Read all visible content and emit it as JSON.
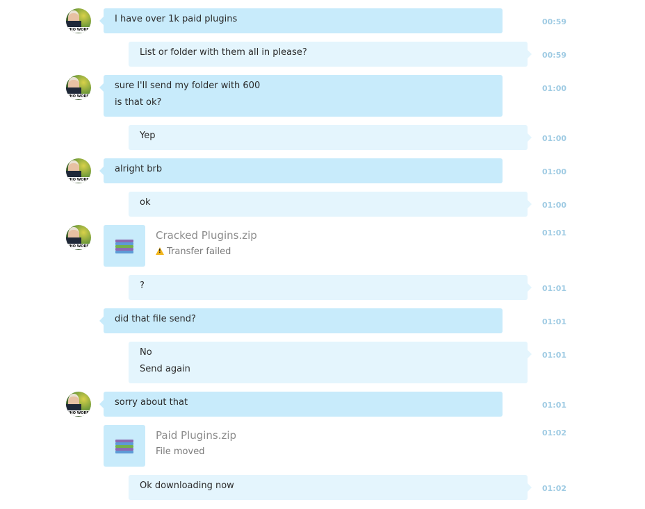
{
  "contact": {
    "avatar_caption": "WHO WORE IT BETTER"
  },
  "messages": [
    {
      "sender": "them",
      "lines": [
        "I have over 1k paid plugins"
      ],
      "time": "00:59"
    },
    {
      "sender": "me",
      "lines": [
        "List or folder with them all in please?"
      ],
      "time": "00:59"
    },
    {
      "sender": "them",
      "lines": [
        "sure I'll send my folder with 600",
        "is that ok?"
      ],
      "time": "01:00"
    },
    {
      "sender": "me",
      "lines": [
        "Yep"
      ],
      "time": "01:00"
    },
    {
      "sender": "them",
      "lines": [
        "alright brb"
      ],
      "time": "01:00"
    },
    {
      "sender": "me",
      "lines": [
        "ok"
      ],
      "time": "01:00"
    },
    {
      "sender": "them",
      "type": "file",
      "file_name": "Cracked Plugins.zip",
      "status": "Transfer failed",
      "status_icon": "warning-icon",
      "time": "01:01"
    },
    {
      "sender": "me",
      "lines": [
        "?"
      ],
      "time": "01:01"
    },
    {
      "sender": "them",
      "lines": [
        "did that file send?"
      ],
      "time": "01:01"
    },
    {
      "sender": "me",
      "lines": [
        "No",
        "Send again"
      ],
      "time": "01:01"
    },
    {
      "sender": "them",
      "lines": [
        "sorry about that"
      ],
      "time": "01:01"
    },
    {
      "sender": "them",
      "type": "file",
      "file_name": "Paid Plugins.zip",
      "status": "File moved",
      "time": "01:02"
    },
    {
      "sender": "me",
      "lines": [
        "Ok downloading now"
      ],
      "time": "01:02"
    }
  ],
  "colors": {
    "incoming_bubble": "#c8ebfb",
    "outgoing_bubble": "#e4f5fd",
    "timestamp": "#9fcbe3",
    "warning": "#f2b51b"
  },
  "icons": {
    "file": "winrar-archive-icon",
    "warning": "warning-icon"
  }
}
